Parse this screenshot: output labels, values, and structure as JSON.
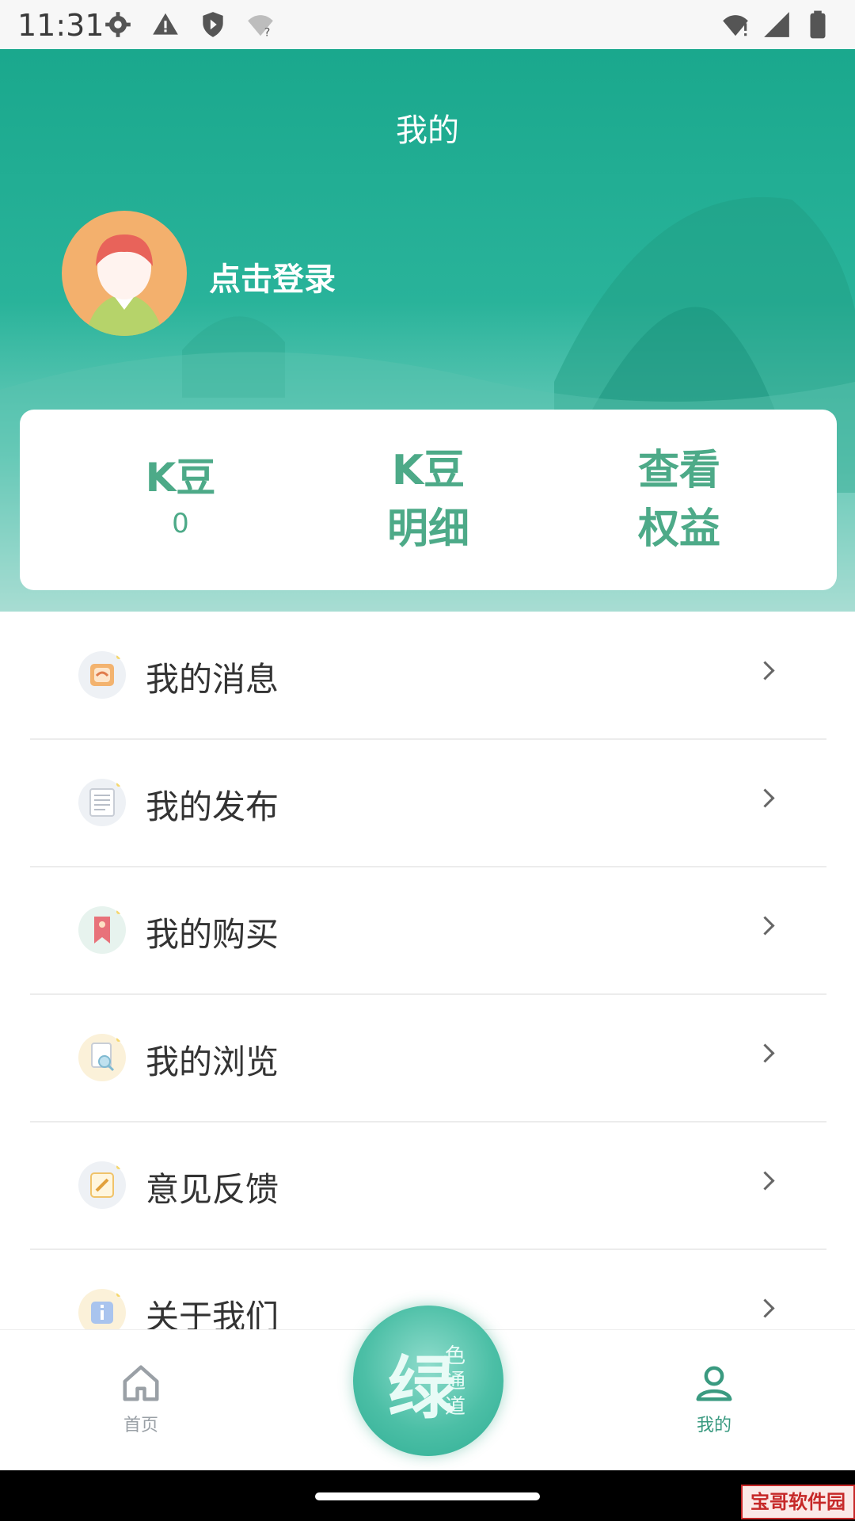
{
  "status_bar": {
    "time": "11:31",
    "icons_left": [
      "settings-icon",
      "warning-icon",
      "shield-icon",
      "wifi-question-icon"
    ],
    "icons_right": [
      "wifi-alert-icon",
      "cell-signal-icon",
      "battery-icon"
    ]
  },
  "header": {
    "title": "我的",
    "login_text": "点击登录"
  },
  "stats_card": {
    "kdou_label": "K豆",
    "kdou_value": "0",
    "detail_line1": "K豆",
    "detail_line2": "明细",
    "benefits_line1": "查看",
    "benefits_line2": "权益"
  },
  "menu": {
    "items": [
      {
        "label": "我的消息",
        "icon": "message-icon"
      },
      {
        "label": "我的发布",
        "icon": "newspaper-icon"
      },
      {
        "label": "我的购买",
        "icon": "bookmark-icon"
      },
      {
        "label": "我的浏览",
        "icon": "browse-icon"
      },
      {
        "label": "意见反馈",
        "icon": "feedback-edit-icon"
      },
      {
        "label": "关于我们",
        "icon": "info-icon"
      }
    ]
  },
  "tabbar": {
    "home_label": "首页",
    "center_text_big": "绿",
    "center_text_small": "色通道",
    "mine_label": "我的"
  },
  "colors": {
    "accent_green": "#1aa88d",
    "stat_text_green": "#4daa88",
    "tab_home_gray": "#9aa0a6",
    "tab_active_green": "#3a9a80"
  },
  "watermark": "宝哥软件园"
}
